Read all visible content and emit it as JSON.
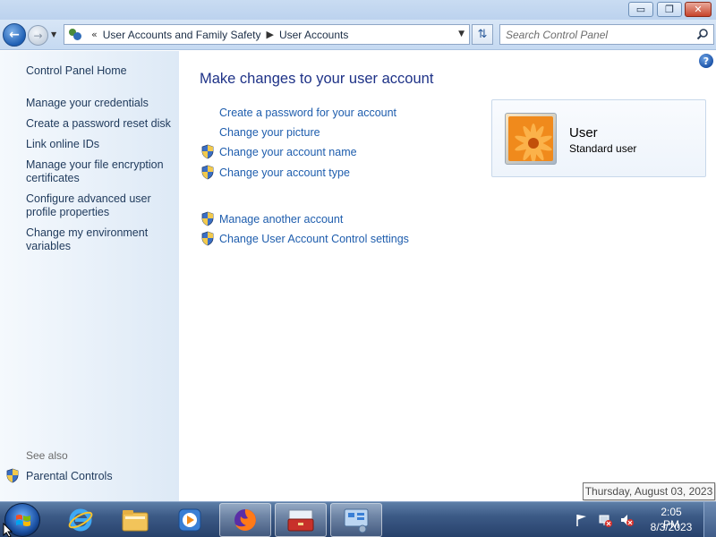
{
  "window": {
    "caption_buttons": {
      "minimize": "▭",
      "maximize": "❐",
      "close": "✕"
    }
  },
  "navbar": {
    "breadcrumb_lead": "«",
    "breadcrumb": [
      "User Accounts and Family Safety",
      "User Accounts"
    ],
    "search_placeholder": "Search Control Panel"
  },
  "sidebar": {
    "home": "Control Panel Home",
    "links": [
      "Manage your credentials",
      "Create a password reset disk",
      "Link online IDs",
      "Manage your file encryption certificates",
      "Configure advanced user profile properties",
      "Change my environment variables"
    ],
    "see_also_label": "See also",
    "see_also_items": [
      "Parental Controls"
    ]
  },
  "main": {
    "title": "Make changes to your user account",
    "tasks": [
      {
        "label": "Create a password for your account",
        "shield": false
      },
      {
        "label": "Change your picture",
        "shield": false
      },
      {
        "label": "Change your account name",
        "shield": true
      },
      {
        "label": "Change your account type",
        "shield": true
      }
    ],
    "other_tasks": [
      {
        "label": "Manage another account",
        "shield": true
      },
      {
        "label": "Change User Account Control settings",
        "shield": true
      }
    ],
    "user_card": {
      "name": "User",
      "type": "Standard user"
    },
    "help": "?"
  },
  "taskbar": {
    "clock_time": "2:05 PM",
    "clock_date": "8/3/2023",
    "tooltip": "Thursday, August 03, 2023",
    "apps": [
      "internet-explorer-icon",
      "file-explorer-icon",
      "media-player-icon",
      "firefox-icon",
      "toolbox-icon",
      "control-panel-icon"
    ]
  },
  "colors": {
    "link": "#1e5dad",
    "title": "#1e3287",
    "sidebar_text": "#1e395b",
    "taskbar": "#3c5a86"
  }
}
